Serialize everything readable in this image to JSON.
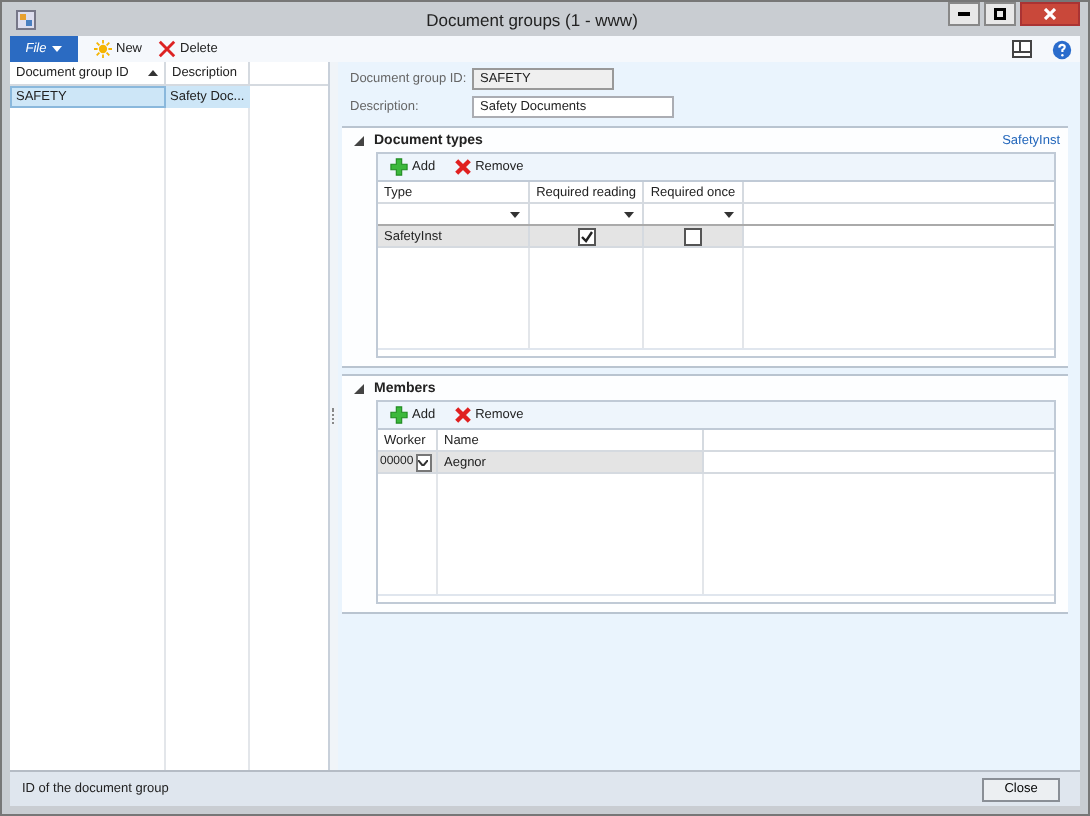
{
  "window": {
    "title": "Document groups (1 - www)"
  },
  "toolbar": {
    "file_menu": "File",
    "buttons": [
      {
        "kind": "new",
        "label": "New"
      },
      {
        "kind": "delete",
        "label": "Delete"
      }
    ]
  },
  "list": {
    "columns": [
      {
        "label": "Document group ID",
        "sorted": true
      },
      {
        "label": "Description",
        "sorted": false
      }
    ],
    "rows": [
      {
        "cells": [
          "SAFETY",
          "Safety Doc..."
        ],
        "selected": true
      }
    ]
  },
  "header_fields": [
    {
      "label": "Document group ID:",
      "value": "SAFETY",
      "disabled": true
    },
    {
      "label": "Description:",
      "value": "Safety Documents",
      "disabled": false
    }
  ],
  "document_types": {
    "title": "Document types",
    "expanded": true,
    "summary": "SafetyInst",
    "actions": [
      {
        "kind": "add",
        "label": "Add"
      },
      {
        "kind": "remove",
        "label": "Remove"
      }
    ],
    "columns": [
      "Type",
      "Required reading",
      "Required once"
    ],
    "rows": [
      {
        "type": "SafetyInst",
        "required_reading": true,
        "required_once": false,
        "selected": true
      }
    ]
  },
  "members": {
    "title": "Members",
    "expanded": true,
    "actions": [
      {
        "kind": "add",
        "label": "Add"
      },
      {
        "kind": "remove",
        "label": "Remove"
      }
    ],
    "columns": [
      "Worker",
      "Name"
    ],
    "rows": [
      {
        "worker": "00000",
        "name": "Aegnor",
        "selected": true
      }
    ]
  },
  "status_bar": {
    "text": "ID of the document group",
    "button": "Close"
  }
}
